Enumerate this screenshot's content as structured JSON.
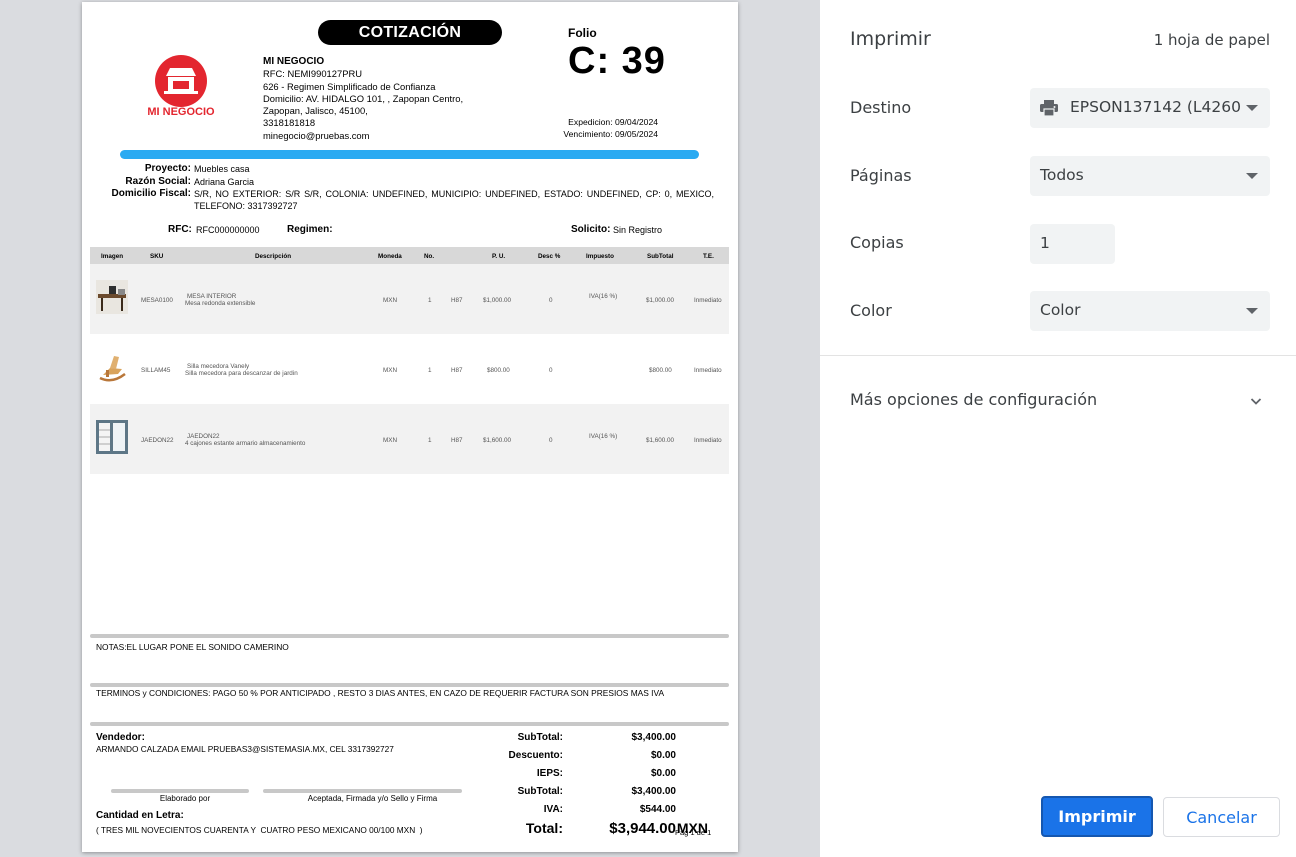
{
  "document": {
    "title": "COTIZACIÓN",
    "logo_text": "MI NEGOCIO",
    "company": {
      "name": "MI NEGOCIO",
      "rfc": "RFC: NEMI990127PRU",
      "regime": "626 - Regimen Simplificado de Confianza",
      "address1": "Domicilio: AV. HIDALGO 101, , Zapopan Centro,",
      "address2": "Zapopan, Jalisco, 45100,",
      "phone": "3318181818",
      "email": "minegocio@pruebas.com"
    },
    "folio_label": "Folio",
    "folio_number": "C: 39",
    "expedition": "Expedicion: 09/04/2024",
    "expiration": "Vencimiento: 09/05/2024",
    "client": {
      "project_label": "Proyecto:",
      "project": "Muebles casa",
      "business_name_label": "Razón Social:",
      "business_name": "Adriana Garcia",
      "fiscal_address_label": "Domicilio Fiscal:",
      "fiscal_address": "S/R, NO EXTERIOR: S/R S/R, COLONIA: UNDEFINED, MUNICIPIO: UNDEFINED, ESTADO: UNDEFINED, CP: 0, MEXICO, TELEFONO: 3317392727",
      "rfc_label": "RFC:",
      "rfc": "RFC000000000",
      "regime_label": "Regimen:",
      "requested_label": "Solicito:",
      "requested": "Sin Registro"
    },
    "columns": [
      "Imagen",
      "SKU",
      "Descripción",
      "Moneda",
      "No.",
      "P. U.",
      "Desc %",
      "Impuesto",
      "SubTotal",
      "T.E."
    ],
    "items": [
      {
        "sku": "MESA0100",
        "name": "MESA INTERIOR",
        "desc": "Mesa redonda extensible",
        "currency": "MXN",
        "qty": "1",
        "unit": "H87",
        "price": "$1,000.00",
        "discount": "0",
        "tax": "IVA(16 %)",
        "subtotal": "$1,000.00",
        "te": "Inmediato"
      },
      {
        "sku": "SILLAM45",
        "name": "Silla mecedora Vanely",
        "desc": "Silla mecedora para descanzar de jardin",
        "currency": "MXN",
        "qty": "1",
        "unit": "H87",
        "price": "$800.00",
        "discount": "0",
        "tax": "",
        "subtotal": "$800.00",
        "te": "Inmediato"
      },
      {
        "sku": "JAEDON22",
        "name": "JAEDON22",
        "desc": "4 cajones estante armario almacenamiento",
        "currency": "MXN",
        "qty": "1",
        "unit": "H87",
        "price": "$1,600.00",
        "discount": "0",
        "tax": "IVA(16 %)",
        "subtotal": "$1,600.00",
        "te": "Inmediato"
      }
    ],
    "notes": "NOTAS:EL LUGAR PONE EL SONIDO   CAMERINO",
    "terms": "TERMINOS y CONDICIONES:  PAGO 50 % POR ANTICIPADO , RESTO 3 DIAS ANTES, EN CAZO DE REQUERIR FACTURA SON PRESIOS MAS IVA",
    "vendor_label": "Vendedor:",
    "vendor": "ARMANDO CALZADA EMAIL PRUEBAS3@SISTEMASIA.MX, CEL 3317392727",
    "signature_made": "Elaborado por",
    "signature_accepted": "Aceptada, Firmada y/o Sello y Firma",
    "amount_letter_label": "Cantidad en Letra:",
    "amount_letter": "( TRES MIL NOVECIENTOS CUARENTA Y  CUATRO PESO MEXICANO 00/100 MXN  )",
    "totals": [
      {
        "label": "SubTotal:",
        "value": "$3,400.00"
      },
      {
        "label": "Descuento:",
        "value": "$0.00"
      },
      {
        "label": "IEPS:",
        "value": "$0.00"
      },
      {
        "label": "SubTotal:",
        "value": "$3,400.00"
      },
      {
        "label": "IVA:",
        "value": "$544.00"
      }
    ],
    "total_label": "Total:",
    "total_value": "$3,944.00",
    "total_currency": "MXN",
    "page_number": "Pag 1 de 1"
  },
  "panel": {
    "title": "Imprimir",
    "sheet_count": "1 hoja de papel",
    "destination_label": "Destino",
    "destination_value": "EPSON137142 (L4260",
    "pages_label": "Páginas",
    "pages_value": "Todos",
    "copies_label": "Copias",
    "copies_value": "1",
    "color_label": "Color",
    "color_value": "Color",
    "more_options": "Más opciones de configuración",
    "print_button": "Imprimir",
    "cancel_button": "Cancelar"
  },
  "colors": {
    "accent": "#1a73e8",
    "progress_bar": "#2aaaf2",
    "logo_red": "#e3262f"
  }
}
